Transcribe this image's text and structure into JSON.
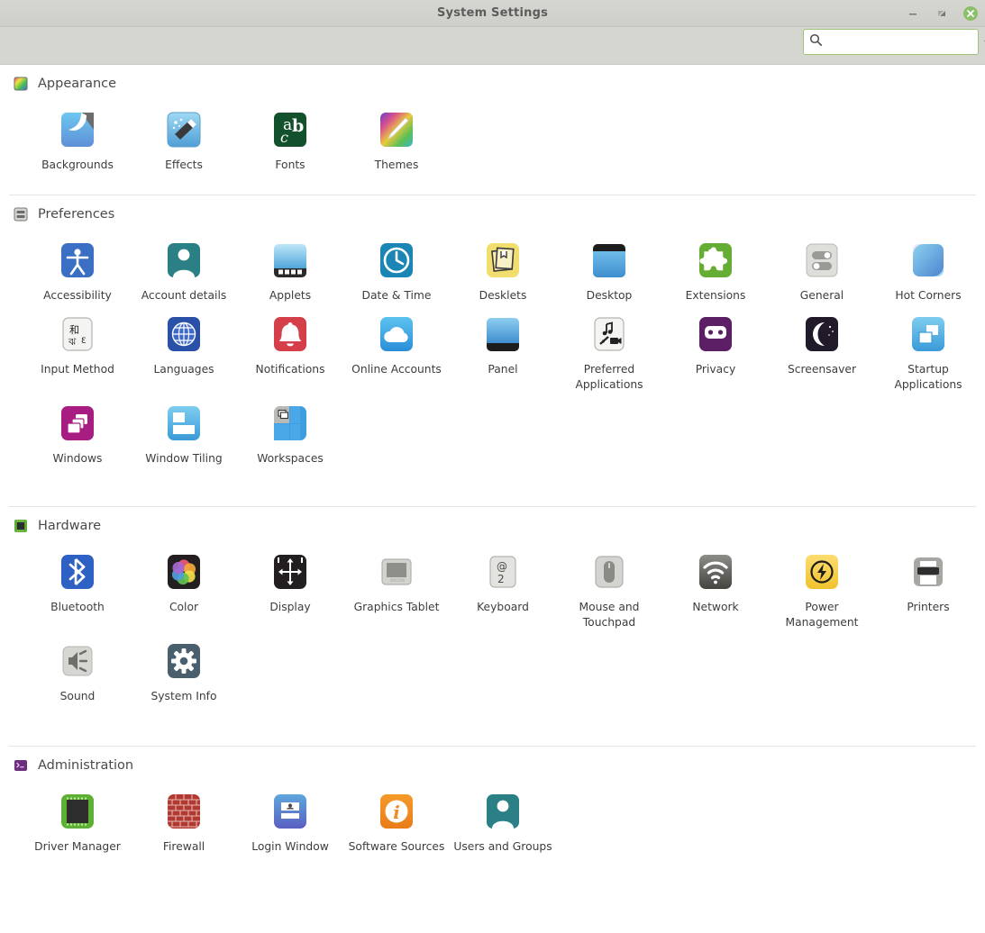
{
  "window": {
    "title": "System Settings",
    "controls": [
      {
        "name": "minimize-button",
        "label": "Minimize",
        "glyph": "minimize"
      },
      {
        "name": "maximize-button",
        "label": "Restore",
        "glyph": "restore"
      },
      {
        "name": "close-button",
        "label": "Close",
        "glyph": "close",
        "color": "#8bbf6a"
      }
    ]
  },
  "search": {
    "value": "",
    "placeholder": "",
    "search_icon": "search-icon",
    "clear_icon": "clear-icon",
    "border_color": "#9ec37b"
  },
  "sections": [
    {
      "id": "appearance",
      "title": "Appearance",
      "icon": "appearance-color-swatch-icon",
      "items": [
        {
          "label": "Backgrounds",
          "icon": "backgrounds-icon"
        },
        {
          "label": "Effects",
          "icon": "effects-magic-wand-icon"
        },
        {
          "label": "Fonts",
          "icon": "fonts-abc-icon"
        },
        {
          "label": "Themes",
          "icon": "themes-paintbrush-icon"
        }
      ]
    },
    {
      "id": "preferences",
      "title": "Preferences",
      "icon": "preferences-sliders-icon",
      "items": [
        {
          "label": "Accessibility",
          "icon": "accessibility-person-icon"
        },
        {
          "label": "Account details",
          "icon": "account-details-user-icon"
        },
        {
          "label": "Applets",
          "icon": "applets-panel-icon"
        },
        {
          "label": "Date & Time",
          "icon": "date-time-clock-icon"
        },
        {
          "label": "Desklets",
          "icon": "desklets-notes-icon"
        },
        {
          "label": "Desktop",
          "icon": "desktop-screen-icon"
        },
        {
          "label": "Extensions",
          "icon": "extensions-puzzle-icon"
        },
        {
          "label": "General",
          "icon": "general-toggles-icon"
        },
        {
          "label": "Hot Corners",
          "icon": "hot-corners-icon"
        },
        {
          "label": "Input Method",
          "icon": "input-method-cjk-icon"
        },
        {
          "label": "Languages",
          "icon": "languages-globe-icon"
        },
        {
          "label": "Notifications",
          "icon": "notifications-bell-icon"
        },
        {
          "label": "Online Accounts",
          "icon": "online-accounts-cloud-icon"
        },
        {
          "label": "Panel",
          "icon": "panel-icon"
        },
        {
          "label": "Preferred Applications",
          "icon": "preferred-applications-icon"
        },
        {
          "label": "Privacy",
          "icon": "privacy-mask-icon"
        },
        {
          "label": "Screensaver",
          "icon": "screensaver-moon-icon"
        },
        {
          "label": "Startup Applications",
          "icon": "startup-applications-icon"
        },
        {
          "label": "Windows",
          "icon": "windows-stack-icon"
        },
        {
          "label": "Window Tiling",
          "icon": "window-tiling-icon"
        },
        {
          "label": "Workspaces",
          "icon": "workspaces-grid-icon"
        }
      ]
    },
    {
      "id": "hardware",
      "title": "Hardware",
      "icon": "hardware-chip-icon",
      "items": [
        {
          "label": "Bluetooth",
          "icon": "bluetooth-icon"
        },
        {
          "label": "Color",
          "icon": "color-wheel-icon"
        },
        {
          "label": "Display",
          "icon": "display-arrows-icon"
        },
        {
          "label": "Graphics Tablet",
          "icon": "graphics-tablet-icon"
        },
        {
          "label": "Keyboard",
          "icon": "keyboard-key-icon"
        },
        {
          "label": "Mouse and Touchpad",
          "icon": "mouse-icon"
        },
        {
          "label": "Network",
          "icon": "network-wifi-icon"
        },
        {
          "label": "Power Management",
          "icon": "power-bolt-icon"
        },
        {
          "label": "Printers",
          "icon": "printer-icon"
        },
        {
          "label": "Sound",
          "icon": "sound-speaker-icon"
        },
        {
          "label": "System Info",
          "icon": "system-info-gear-icon"
        }
      ]
    },
    {
      "id": "administration",
      "title": "Administration",
      "icon": "administration-terminal-icon",
      "items": [
        {
          "label": "Driver Manager",
          "icon": "driver-manager-icon"
        },
        {
          "label": "Firewall",
          "icon": "firewall-brick-icon"
        },
        {
          "label": "Login Window",
          "icon": "login-window-icon"
        },
        {
          "label": "Software Sources",
          "icon": "software-sources-info-icon"
        },
        {
          "label": "Users and Groups",
          "icon": "users-and-groups-icon"
        }
      ]
    }
  ]
}
